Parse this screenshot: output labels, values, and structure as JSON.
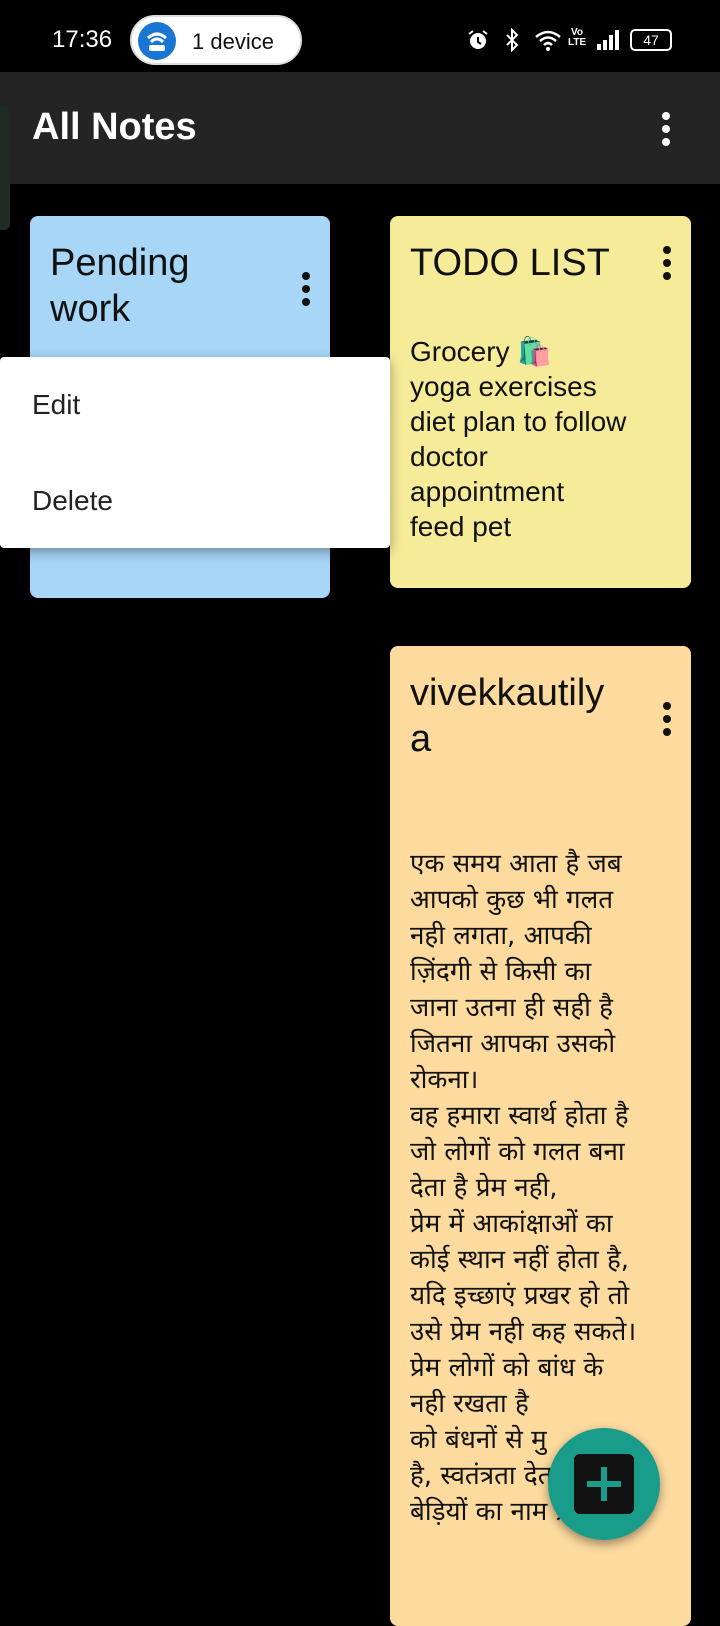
{
  "status_bar": {
    "time": "17:36",
    "hotspot_label": "1 device",
    "battery": "47",
    "network_label": "Vo LTE",
    "icons": [
      "alarm-icon",
      "bluetooth-icon",
      "wifi-icon",
      "volte-icon",
      "signal-icon",
      "battery-icon"
    ]
  },
  "toolbar": {
    "title": "All Notes",
    "menu_icon": "more-vert-icon"
  },
  "notes": [
    {
      "title": "Pending work",
      "body": "",
      "color": "#a7d6f7"
    },
    {
      "title": "TODO LIST",
      "body": "Grocery 🛍️\nyoga exercises\ndiet plan to follow\ndoctor\nappointment\nfeed pet",
      "color": "#f5eb99"
    },
    {
      "title": "vivekkautilya",
      "body": "एक समय आता है जब\nआपको कुछ भी गलत\nनही लगता, आपकी\nज़िंदगी से किसी का\nजाना उतना ही सही है\nजितना आपका उसको\nरोकना।\nवह हमारा स्वार्थ होता है\nजो लोगों को गलत बना\nदेता है प्रेम नही,\nप्रेम में आकांक्षाओं का\nकोई स्थान नहीं होता है,\nयदि इच्छाएं प्रखर हो तो\nउसे प्रेम नही कह सकते।\nप्रेम लोगों को बांध के\nनही रखता है\nको बंधनों से मु\nहै, स्वतंत्रता देता है,\nबेड़ियों का नाम प्रेम होता",
      "color": "#fddb9f"
    }
  ],
  "popup_menu": {
    "items": [
      "Edit",
      "Delete"
    ]
  },
  "fab": {
    "icon": "add-icon",
    "color": "#1a9c8a"
  }
}
